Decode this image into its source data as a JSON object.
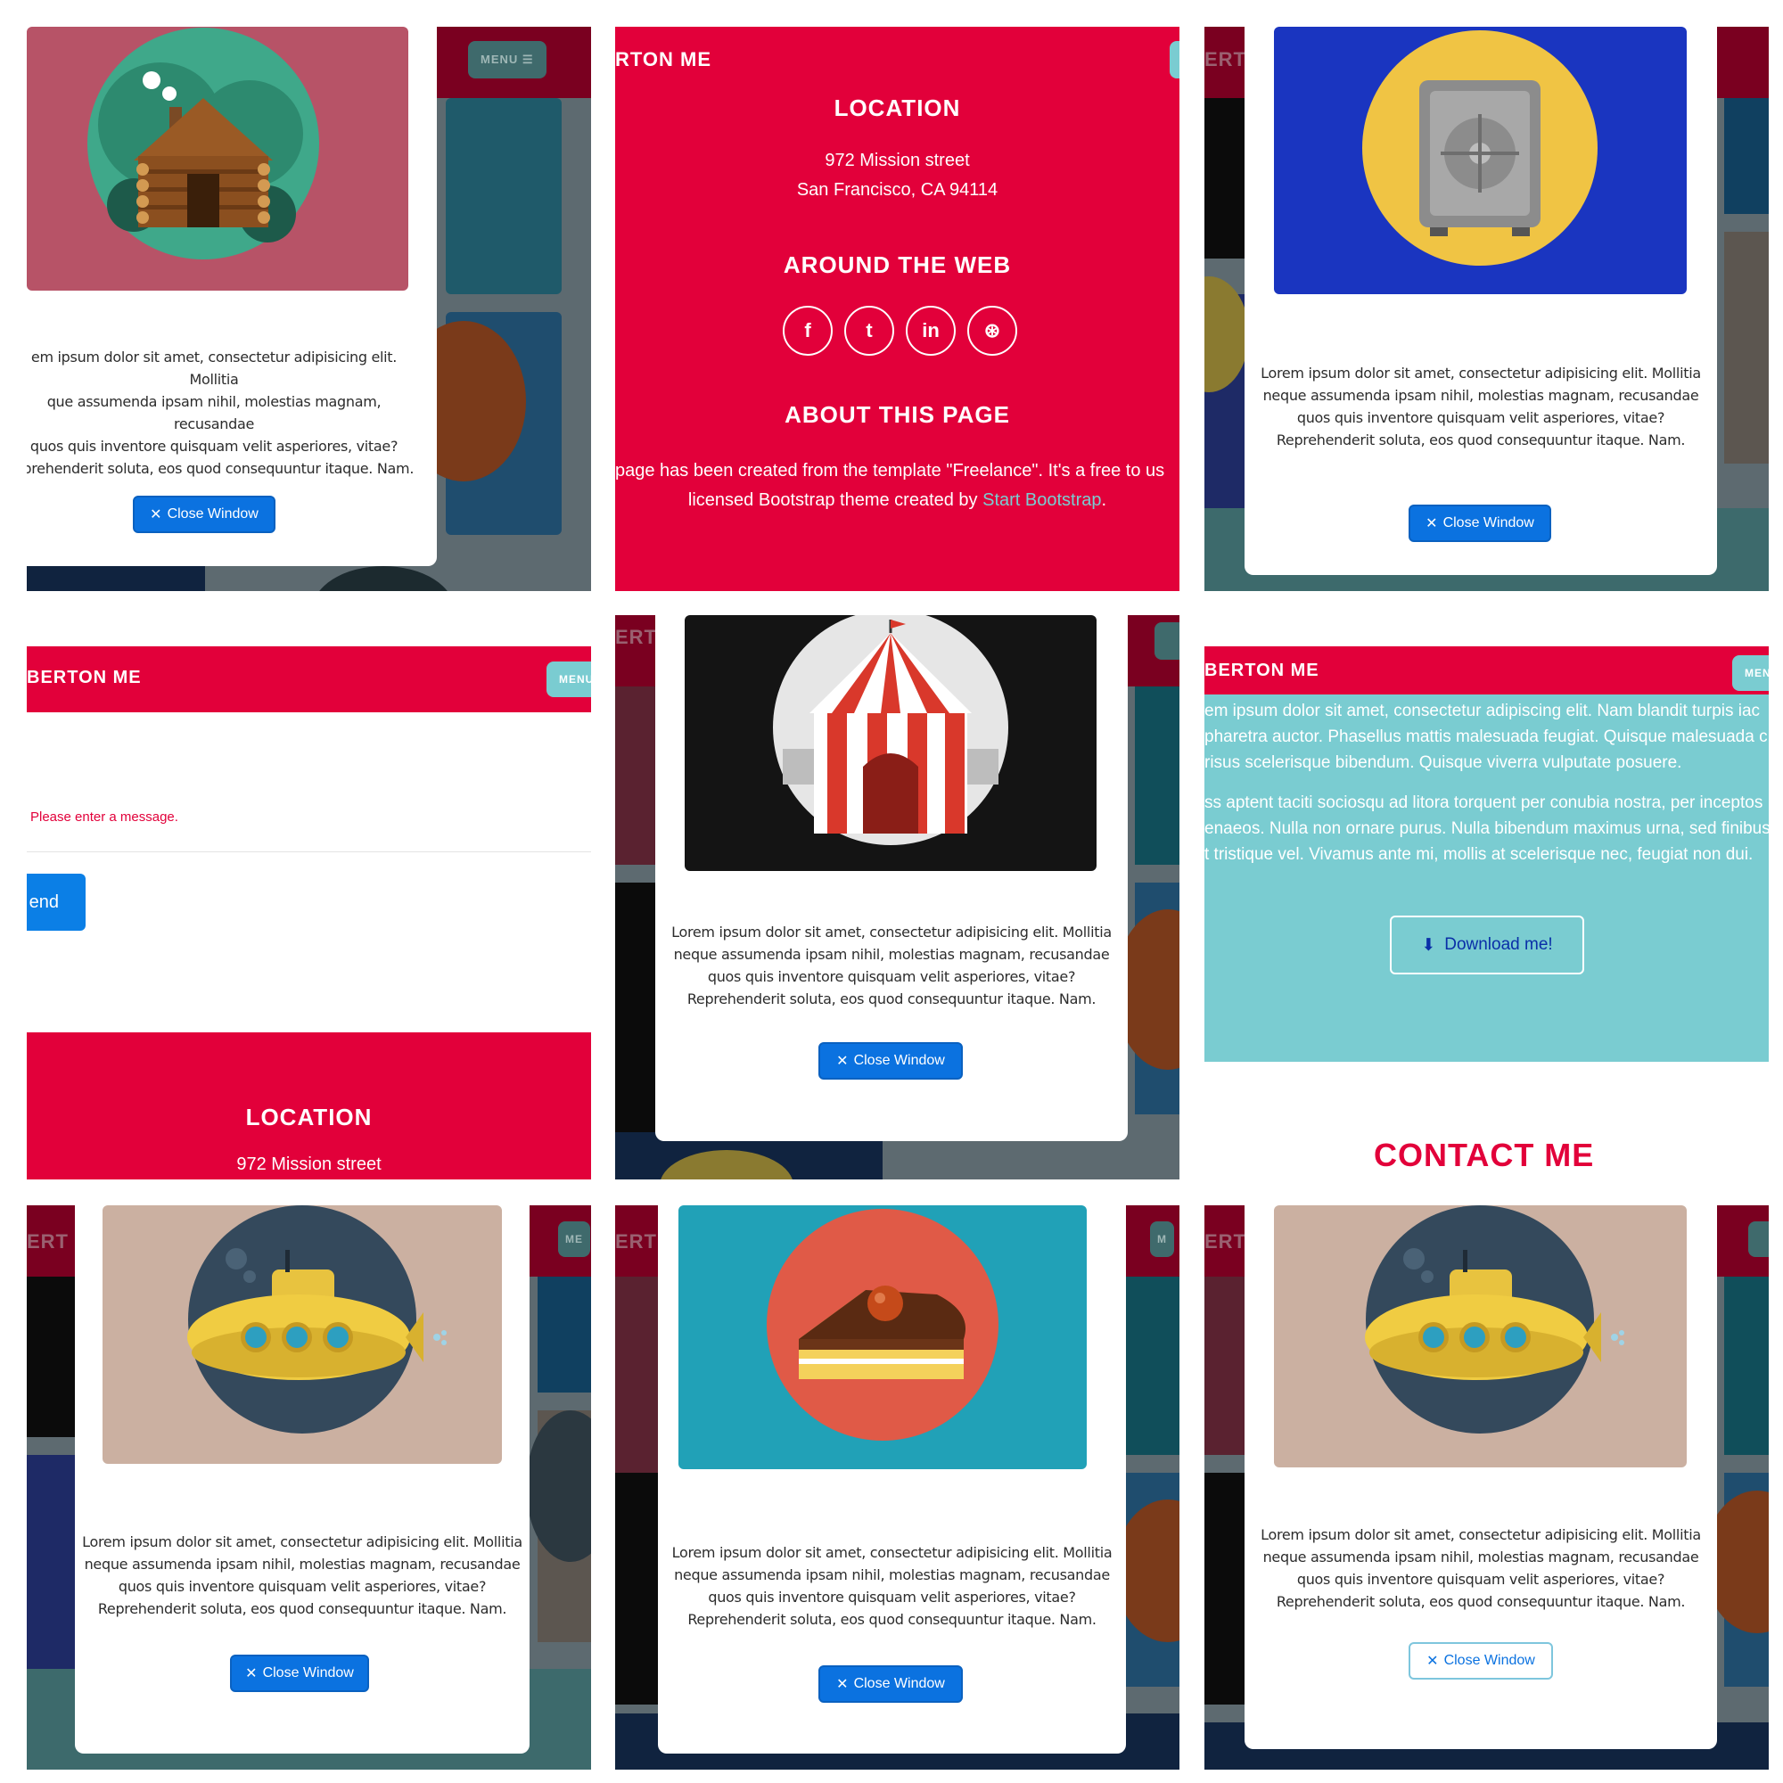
{
  "brand": {
    "name_cut_a": "RTON ME",
    "name_cut_b": "BERTON ME",
    "name_cut_c": "ERT",
    "menu_label": "MENU ☰",
    "menu_cut_a": "MENU",
    "menu_cut_b": "MEN",
    "menu_cut_c": "ME",
    "menu_cut_d": "M"
  },
  "colors": {
    "primary_red": "#e2003a",
    "teal": "#7accd1",
    "button_blue": "#0b72e0",
    "download_text": "#0a2fa8"
  },
  "modal": {
    "body_lines": [
      "Lorem ipsum dolor sit amet, consectetur adipisicing elit. Mollitia",
      "neque assumenda ipsam nihil, molestias magnam, recusandae",
      "quos quis inventore quisquam velit asperiores, vitae?",
      "Reprehenderit soluta, eos quod consequuntur itaque. Nam."
    ],
    "body_lines_cut": [
      "em ipsum dolor sit amet, consectetur adipisicing elit. Mollitia",
      "que assumenda ipsam nihil, molestias magnam, recusandae",
      "quos quis inventore quisquam velit asperiores, vitae?",
      "eprehenderit soluta, eos quod consequuntur itaque. Nam."
    ],
    "close_label": "Close Window",
    "close_icon": "x-icon"
  },
  "footer": {
    "location_heading": "LOCATION",
    "address_line1": "972 Mission street",
    "address_line2": "San Francisco, CA 94114",
    "web_heading": "AROUND THE WEB",
    "social_icons": [
      "facebook-icon",
      "twitter-icon",
      "linkedin-icon",
      "dribbble-icon"
    ],
    "social_glyphs": [
      "f",
      "t",
      "in",
      "⊛"
    ],
    "about_heading": "ABOUT THIS PAGE",
    "about_line1": "page has been created from the template \"Freelance\". It's a free to us",
    "about_line2_pre": "licensed Bootstrap theme created by ",
    "about_link": "Start Bootstrap",
    "about_line2_post": "."
  },
  "contact_form": {
    "error_message": "Please enter a message.",
    "send_label": "Send"
  },
  "about_section": {
    "lines": [
      "em ipsum dolor sit amet, consectetur adipiscing elit. Nam blandit turpis iac",
      "pharetra auctor. Phasellus mattis malesuada feugiat. Quisque malesuada c",
      "risus scelerisque bibendum. Quisque viverra vulputate posuere.",
      "ss aptent taciti sociosqu ad litora torquent per conubia nostra, per inceptos",
      "enaeos. Nulla non ornare purus. Nulla bibendum maximus urna, sed finibus",
      "t tristique vel. Vivamus ante mi, mollis at scelerisque nec, feugiat non dui."
    ],
    "download_label": "Download me!",
    "contact_heading": "CONTACT ME"
  }
}
